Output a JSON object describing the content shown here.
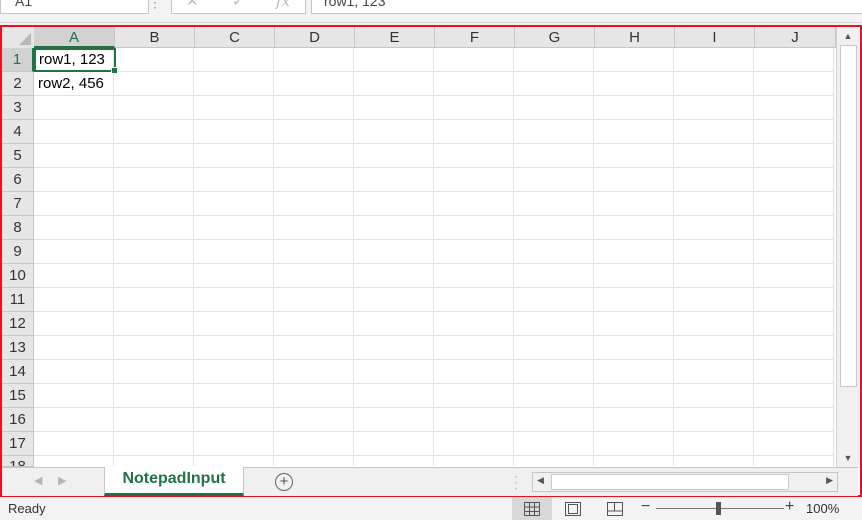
{
  "formula_bar": {
    "name_box": "A1",
    "formula": "row1, 123"
  },
  "columns": [
    "A",
    "B",
    "C",
    "D",
    "E",
    "F",
    "G",
    "H",
    "I",
    "J"
  ],
  "rows": [
    "1",
    "2",
    "3",
    "4",
    "5",
    "6",
    "7",
    "8",
    "9",
    "10",
    "11",
    "12",
    "13",
    "14",
    "15",
    "16",
    "17",
    "18"
  ],
  "cells": {
    "A1": "row1, 123",
    "A2": "row2, 456"
  },
  "sheet_tab": {
    "name": "NotepadInput"
  },
  "status": {
    "text": "Ready",
    "zoom": "100%"
  },
  "colors": {
    "accent": "#217346",
    "highlight_border": "#e81123"
  }
}
